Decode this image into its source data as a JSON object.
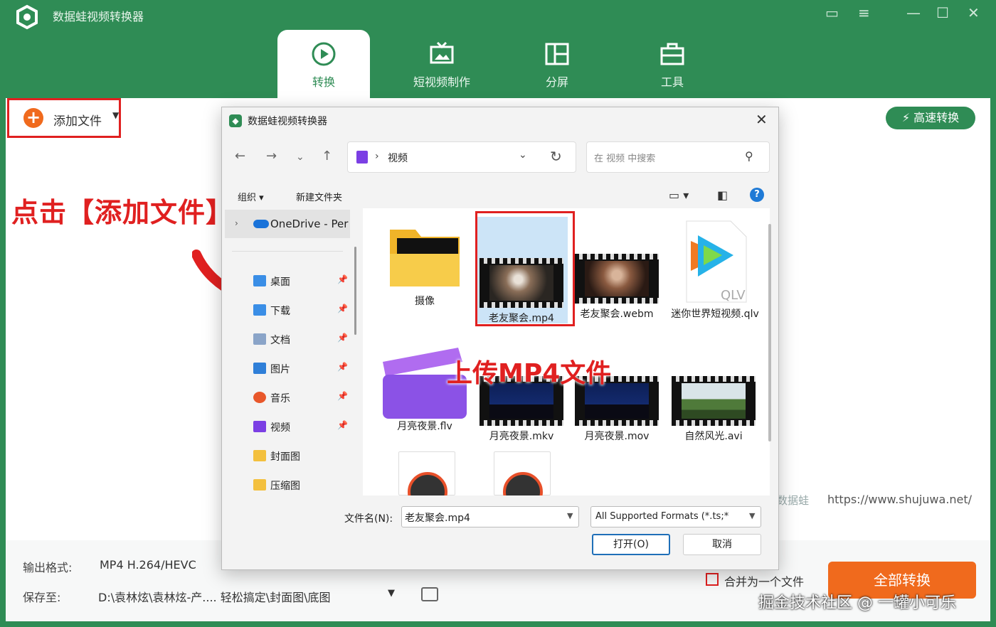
{
  "app": {
    "title": "数据蛙视频转换器",
    "tabs": [
      {
        "label": "转换",
        "icon": "convert-icon",
        "active": true
      },
      {
        "label": "短视频制作",
        "icon": "tv-icon",
        "active": false
      },
      {
        "label": "分屏",
        "icon": "split-screen-icon",
        "active": false
      },
      {
        "label": "工具",
        "icon": "toolbox-icon",
        "active": false
      }
    ],
    "add_file_label": "添加文件",
    "fast_convert_label": "高速转换",
    "site_label": "数据蛙",
    "site_url": "https://www.shujuwa.net/",
    "output_format_label": "输出格式:",
    "output_format_value": "MP4 H.264/HEVC",
    "save_to_label": "保存至:",
    "save_to_value": "D:\\袁林炫\\袁林炫-产.... 轻松搞定\\封面图\\底图",
    "merge_label": "合并为一个文件",
    "convert_all_label": "全部转换"
  },
  "annotations": {
    "click_add": "点击【添加文件】",
    "upload_mp4": "上传MP4文件"
  },
  "watermark": "掘金技术社区 @ 一罐小可乐",
  "dialog": {
    "title": "数据蛙视频转换器",
    "path": "视频",
    "search_placeholder": "在 视频 中搜索",
    "organize_label": "组织 ▾",
    "new_folder_label": "新建文件夹",
    "sidebar": {
      "onedrive": "OneDrive - Per",
      "items": [
        {
          "label": "桌面",
          "icon": "desktop-icon",
          "color": "#3a8ee6"
        },
        {
          "label": "下载",
          "icon": "download-icon",
          "color": "#3a8ee6"
        },
        {
          "label": "文档",
          "icon": "document-icon",
          "color": "#8aa4c8"
        },
        {
          "label": "图片",
          "icon": "pictures-icon",
          "color": "#2f7fd8"
        },
        {
          "label": "音乐",
          "icon": "music-icon",
          "color": "#e8572a"
        },
        {
          "label": "视频",
          "icon": "videos-icon",
          "color": "#7b3fe4"
        },
        {
          "label": "封面图",
          "icon": "folder-icon",
          "color": "#f3c03e"
        },
        {
          "label": "压缩图",
          "icon": "folder-icon",
          "color": "#f3c03e"
        }
      ]
    },
    "files": [
      {
        "name": "摄像"
      },
      {
        "name": "老友聚会.mp4"
      },
      {
        "name": "老友聚会.webm"
      },
      {
        "name": "迷你世界短视频.qlv"
      },
      {
        "name": "月亮夜景.flv"
      },
      {
        "name": "月亮夜景.mkv"
      },
      {
        "name": "月亮夜景.mov"
      },
      {
        "name": "自然风光.avi"
      }
    ],
    "file_name_label": "文件名(N):",
    "file_name_value": "老友聚会.mp4",
    "file_type_value": "All Supported Formats (*.ts;*",
    "open_label": "打开(O)",
    "cancel_label": "取消"
  }
}
